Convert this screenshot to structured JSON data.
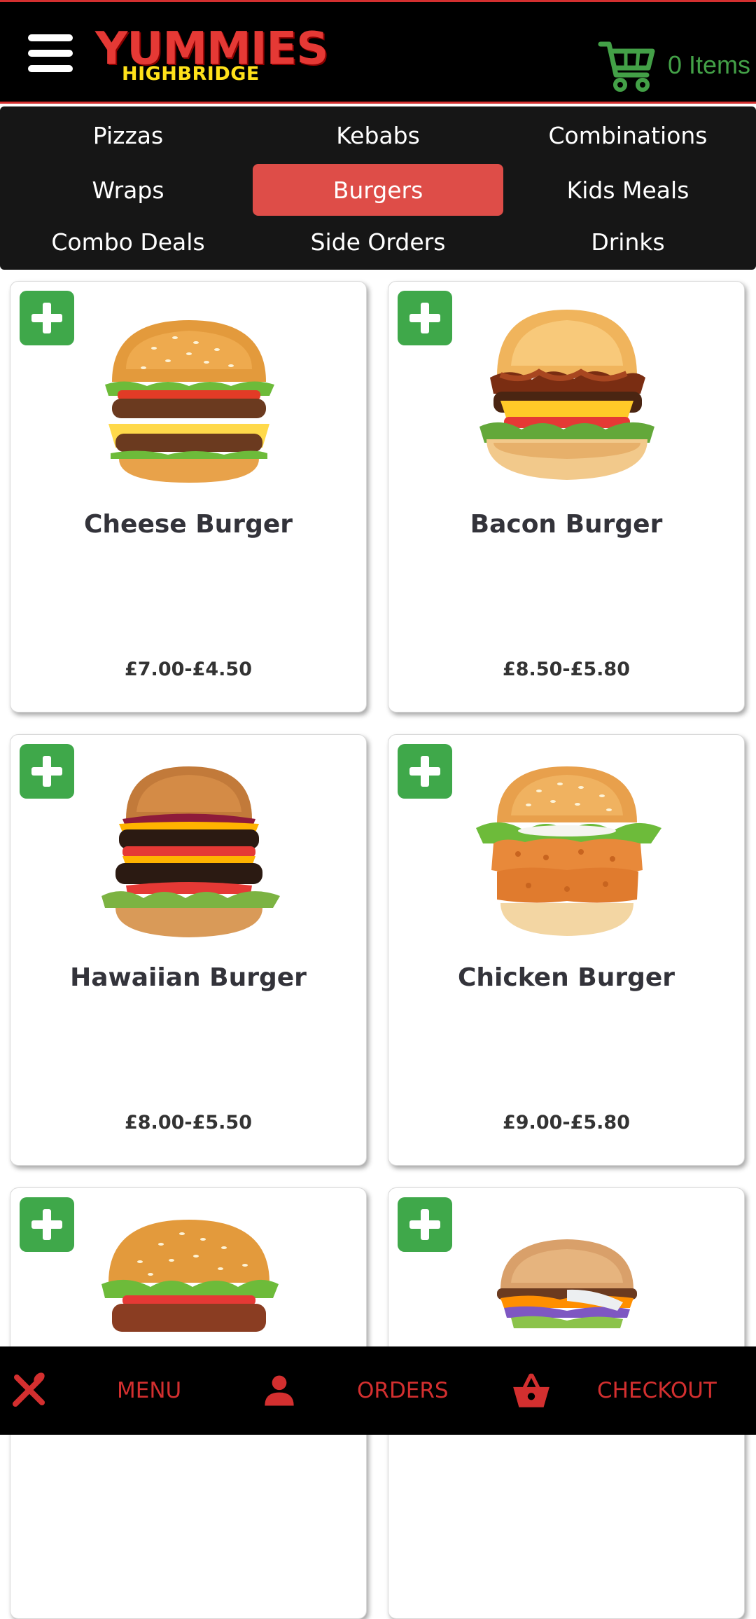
{
  "header": {
    "logo_main": "YUMMIES",
    "logo_sub": "HIGHBRIDGE",
    "cart_label": "0 Items"
  },
  "categories": [
    {
      "label": "Pizzas",
      "active": false
    },
    {
      "label": "Kebabs",
      "active": false
    },
    {
      "label": "Combinations",
      "active": false
    },
    {
      "label": "Wraps",
      "active": false
    },
    {
      "label": "Burgers",
      "active": true
    },
    {
      "label": "Kids Meals",
      "active": false
    },
    {
      "label": "Combo Deals",
      "active": false
    },
    {
      "label": "Side Orders",
      "active": false
    },
    {
      "label": "Drinks",
      "active": false
    }
  ],
  "products": [
    {
      "name": "Cheese Burger",
      "price": "£7.00-£4.50"
    },
    {
      "name": "Bacon Burger",
      "price": "£8.50-£5.80"
    },
    {
      "name": "Hawaiian Burger",
      "price": "£8.00-£5.50"
    },
    {
      "name": "Chicken Burger",
      "price": "£9.00-£5.80"
    },
    {
      "name": "",
      "price": ""
    },
    {
      "name": "",
      "price": ""
    }
  ],
  "bottom_nav": {
    "menu_label": "MENU",
    "orders_label": "ORDERS",
    "checkout_label": "CHECKOUT"
  },
  "colors": {
    "brand_red": "#d32f2f",
    "logo_yellow": "#ffe11a",
    "cart_green": "#43a047",
    "add_green": "#3fa84a",
    "active_tab": "#de4d48",
    "nav_bg": "#161616"
  },
  "icons": {
    "menu": "hamburger-menu-icon",
    "cart": "shopping-cart-icon",
    "add": "plus-icon",
    "bottom_menu": "fork-knife-icon",
    "bottom_orders": "person-icon",
    "bottom_checkout": "basket-icon"
  }
}
